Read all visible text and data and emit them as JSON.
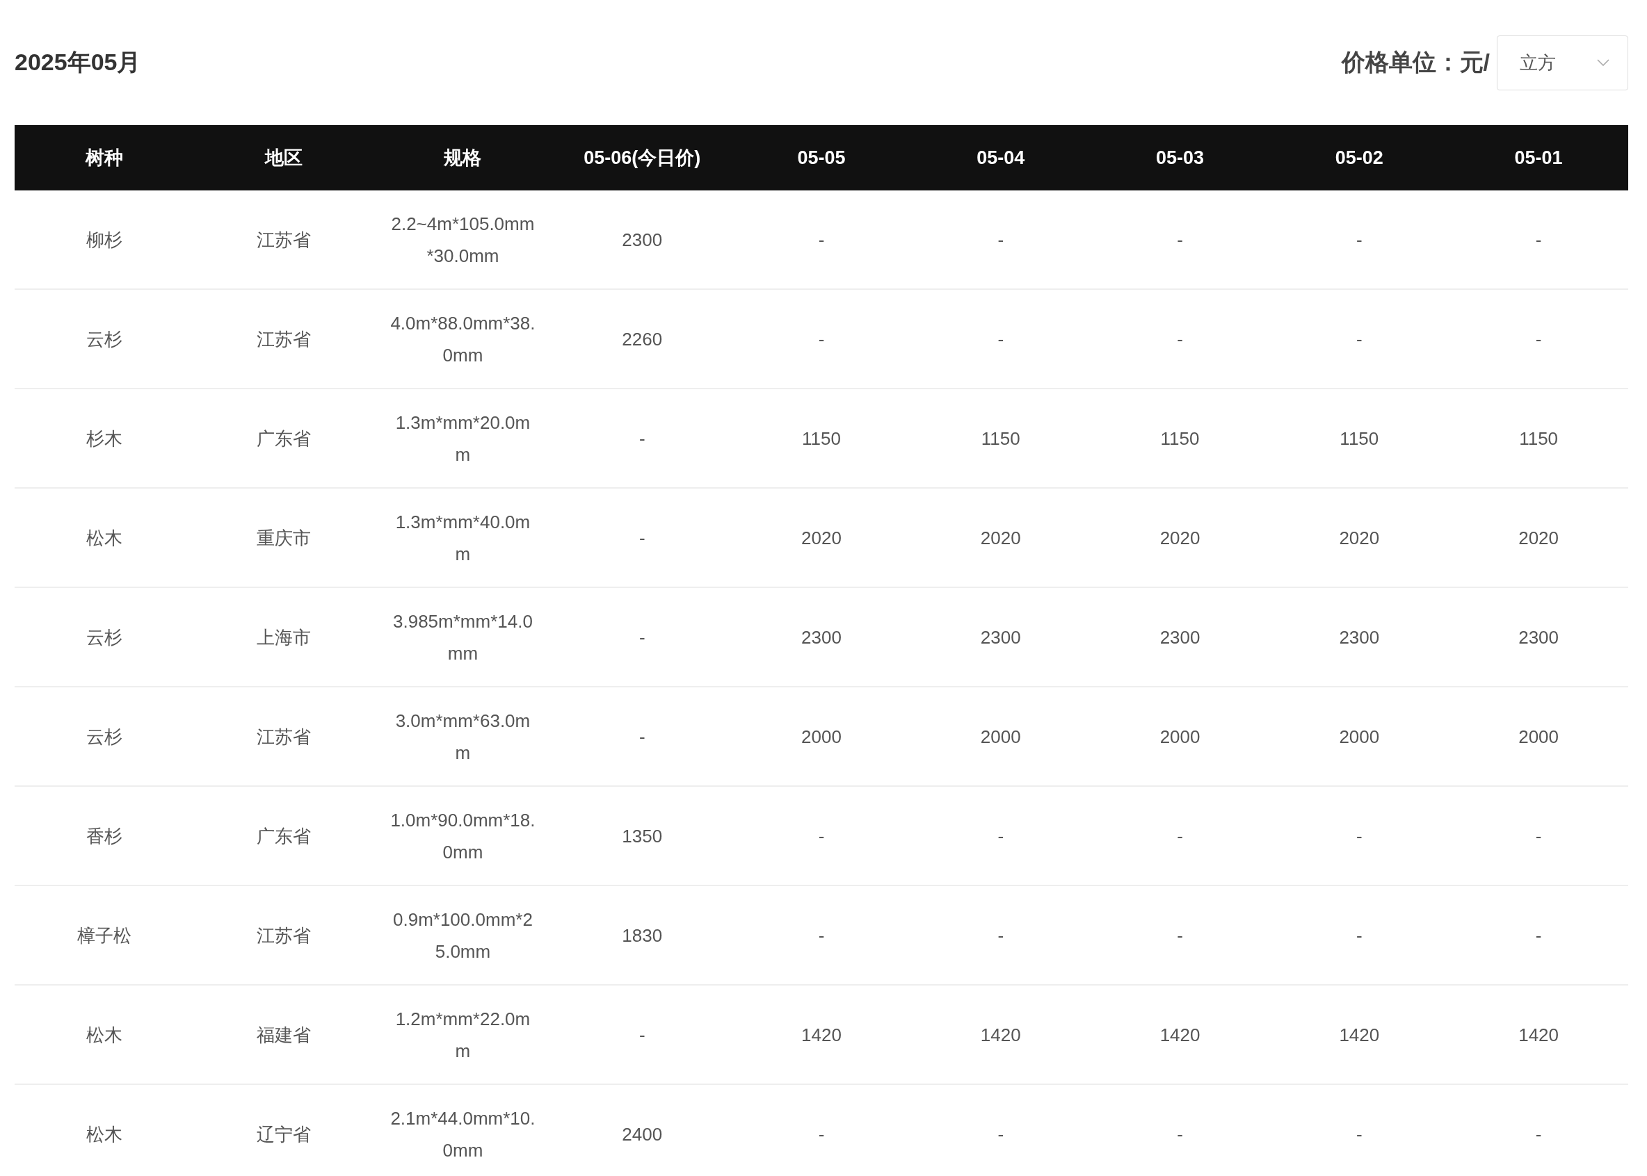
{
  "title": "2025年05月",
  "price_unit": {
    "label": "价格单位：元/",
    "value": "立方"
  },
  "table": {
    "columns": [
      "树种",
      "地区",
      "规格",
      "05-06(今日价)",
      "05-05",
      "05-04",
      "05-03",
      "05-02",
      "05-01"
    ],
    "rows": [
      [
        "柳杉",
        "江苏省",
        "2.2~4m*105.0mm*30.0mm",
        "2300",
        "-",
        "-",
        "-",
        "-",
        "-"
      ],
      [
        "云杉",
        "江苏省",
        "4.0m*88.0mm*38.0mm",
        "2260",
        "-",
        "-",
        "-",
        "-",
        "-"
      ],
      [
        "杉木",
        "广东省",
        "1.3m*mm*20.0mm",
        "-",
        "1150",
        "1150",
        "1150",
        "1150",
        "1150"
      ],
      [
        "松木",
        "重庆市",
        "1.3m*mm*40.0mm",
        "-",
        "2020",
        "2020",
        "2020",
        "2020",
        "2020"
      ],
      [
        "云杉",
        "上海市",
        "3.985m*mm*14.0mm",
        "-",
        "2300",
        "2300",
        "2300",
        "2300",
        "2300"
      ],
      [
        "云杉",
        "江苏省",
        "3.0m*mm*63.0mm",
        "-",
        "2000",
        "2000",
        "2000",
        "2000",
        "2000"
      ],
      [
        "香杉",
        "广东省",
        "1.0m*90.0mm*18.0mm",
        "1350",
        "-",
        "-",
        "-",
        "-",
        "-"
      ],
      [
        "樟子松",
        "江苏省",
        "0.9m*100.0mm*25.0mm",
        "1830",
        "-",
        "-",
        "-",
        "-",
        "-"
      ],
      [
        "松木",
        "福建省",
        "1.2m*mm*22.0mm",
        "-",
        "1420",
        "1420",
        "1420",
        "1420",
        "1420"
      ],
      [
        "松木",
        "辽宁省",
        "2.1m*44.0mm*10.0mm",
        "2400",
        "-",
        "-",
        "-",
        "-",
        "-"
      ]
    ]
  }
}
